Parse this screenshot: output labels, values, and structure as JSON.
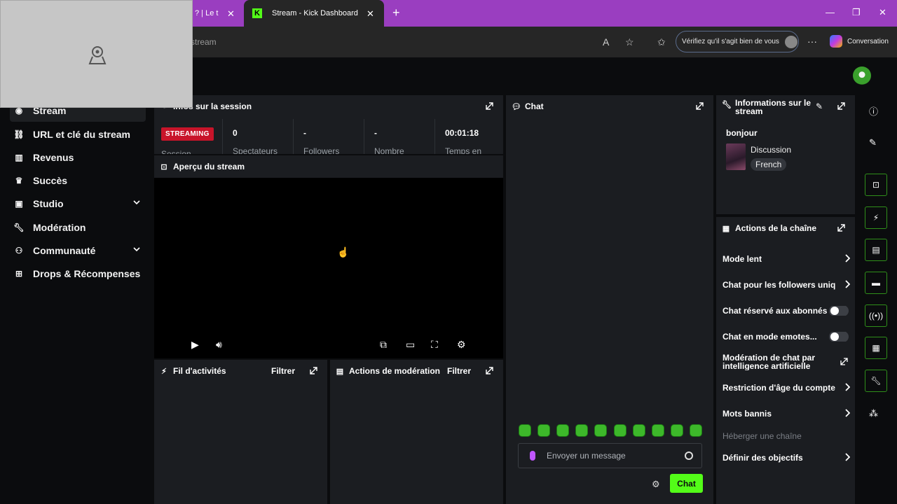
{
  "browser": {
    "tabs": [
      {
        "label": "? | Le t"
      },
      {
        "label": "Stream - Kick Dashboard"
      }
    ],
    "new_tab_label": "+",
    "address_text": "stream",
    "verify_label": "Vérifiez qu'il s'agit bien de vous",
    "conversation_label": "Conversation"
  },
  "sidebar": {
    "items": [
      {
        "label": "Stream"
      },
      {
        "label": "URL et clé du stream"
      },
      {
        "label": "Revenus"
      },
      {
        "label": "Succès"
      },
      {
        "label": "Studio"
      },
      {
        "label": "Modération"
      },
      {
        "label": "Communauté"
      },
      {
        "label": "Drops & Récompenses"
      }
    ]
  },
  "session": {
    "title": "Infos sur la session",
    "badge": "STREAMING",
    "stats": [
      {
        "value": "0",
        "label": "Spectateurs"
      },
      {
        "value": "-",
        "label": "Followers"
      },
      {
        "value": "-",
        "label": "Nombre"
      },
      {
        "value": "00:01:18",
        "label": "Temps en"
      }
    ],
    "left_label": "Session"
  },
  "preview": {
    "title": "Aperçu du stream"
  },
  "activity": {
    "title": "Fil d'activités",
    "filter": "Filtrer"
  },
  "modactions": {
    "title": "Actions de modération",
    "filter": "Filtrer"
  },
  "chat": {
    "title": "Chat",
    "placeholder": "Envoyer un message",
    "send_label": "Chat"
  },
  "info": {
    "title": "Informations sur le stream",
    "stream_title": "bonjour",
    "category": "Discussion",
    "language": "French"
  },
  "channel_actions": {
    "title": "Actions de la chaîne",
    "rows": [
      {
        "label": "Mode lent"
      },
      {
        "label": "Chat pour les followers uniquement"
      },
      {
        "label": "Chat réservé aux abonnés"
      },
      {
        "label": "Chat en mode emotes..."
      },
      {
        "label": "Modération de chat par intelligence artificielle"
      },
      {
        "label": "Restriction d'âge du compte"
      },
      {
        "label": "Mots bannis"
      },
      {
        "label": "Héberger une chaîne"
      },
      {
        "label": "Définir des objectifs"
      }
    ]
  },
  "colors": {
    "accent": "#53fc18",
    "browser": "#9a3ec0",
    "live": "#c8142a"
  }
}
